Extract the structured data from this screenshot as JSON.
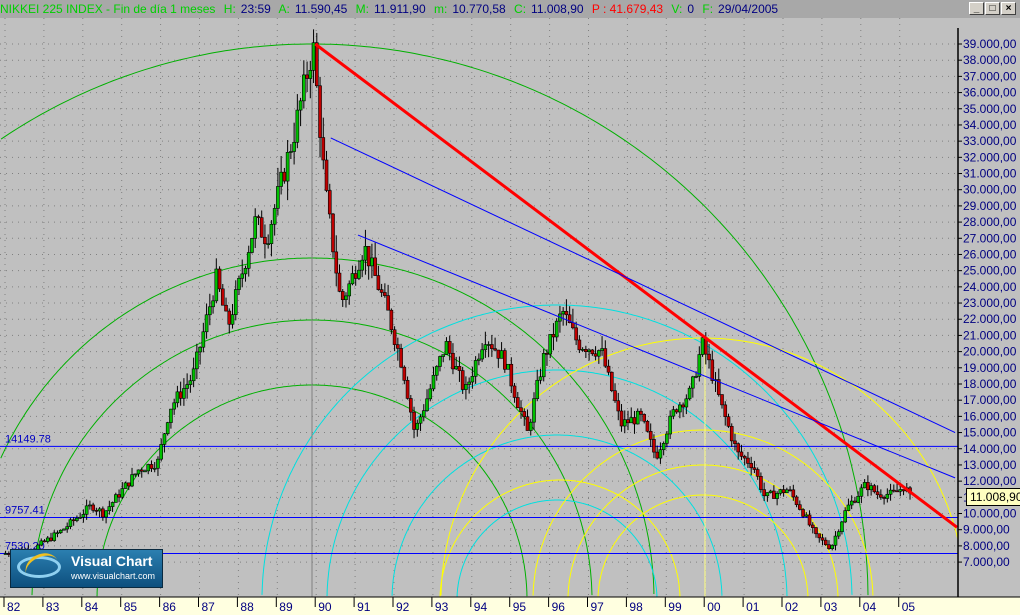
{
  "header": {
    "title": "NIKKEI 225 INDEX - Fin de día 1 meses",
    "h_label": "H:",
    "h": "23:59",
    "a_label": "A:",
    "a": "11.590,45",
    "m_label": "M:",
    "m": "11.911,90",
    "lo_label": "m:",
    "lo": "10.770,58",
    "c_label": "C:",
    "c": "11.008,90",
    "p": "P : 41.679,43",
    "v_label": "V:",
    "v": "0",
    "f_label": "F:",
    "f": "29/04/2005"
  },
  "window_buttons": {
    "minimize": "_",
    "maximize": "□",
    "close": "×"
  },
  "logo": {
    "name": "Visual Chart",
    "url": "www.visualchart.com"
  },
  "current_price": "11.008,90",
  "colors": {
    "background": "#c0c0c0",
    "up": "#00c000",
    "down": "#c00000",
    "trend": "#ff0000",
    "channel": "#0000ff",
    "arc_green": "#00b000",
    "arc_cyan": "#00e0e0",
    "arc_yellow": "#ffff00"
  },
  "chart_data": {
    "type": "candlestick",
    "title": "NIKKEI 225 INDEX",
    "ylim": [
      6000,
      40000
    ],
    "y_ticks": [
      7000,
      8000,
      9000,
      10000,
      11000,
      12000,
      13000,
      14000,
      15000,
      16000,
      17000,
      18000,
      19000,
      20000,
      21000,
      22000,
      23000,
      24000,
      25000,
      26000,
      27000,
      28000,
      29000,
      30000,
      31000,
      32000,
      33000,
      34000,
      35000,
      36000,
      37000,
      38000,
      39000
    ],
    "y_tick_labels": [
      "7.000,00",
      "8.000,00",
      "9.000,00",
      "10.000,00",
      "11.000,00",
      "12.000,00",
      "13.000,00",
      "14.000,00",
      "15.000,00",
      "16.000,00",
      "17.000,00",
      "18.000,00",
      "19.000,00",
      "20.000,00",
      "21.000,00",
      "22.000,00",
      "23.000,00",
      "24.000,00",
      "25.000,00",
      "26.000,00",
      "27.000,00",
      "28.000,00",
      "29.000,00",
      "30.000,00",
      "31.000,00",
      "32.000,00",
      "33.000,00",
      "34.000,00",
      "35.000,00",
      "36.000,00",
      "37.000,00",
      "38.000,00",
      "39.000,00"
    ],
    "x_ticks": [
      1982,
      1983,
      1984,
      1985,
      1986,
      1987,
      1988,
      1989,
      1990,
      1991,
      1992,
      1993,
      1994,
      1995,
      1996,
      1997,
      1998,
      1999,
      2000,
      2001,
      2002,
      2003,
      2004,
      2005
    ],
    "x_tick_labels": [
      "82",
      "83",
      "84",
      "85",
      "86",
      "87",
      "88",
      "89",
      "90",
      "91",
      "92",
      "93",
      "94",
      "95",
      "96",
      "97",
      "98",
      "99",
      "00",
      "01",
      "02",
      "03",
      "04",
      "05"
    ],
    "keypoints": [
      [
        1982.0,
        7500
      ],
      [
        1982.8,
        7800
      ],
      [
        1983.5,
        8900
      ],
      [
        1984.3,
        10500
      ],
      [
        1984.6,
        10000
      ],
      [
        1985.5,
        12700
      ],
      [
        1986.0,
        13200
      ],
      [
        1986.3,
        16500
      ],
      [
        1986.9,
        18500
      ],
      [
        1987.5,
        24500
      ],
      [
        1987.8,
        21500
      ],
      [
        1988.5,
        28000
      ],
      [
        1988.8,
        27000
      ],
      [
        1989.5,
        33500
      ],
      [
        1989.99,
        38900
      ],
      [
        1990.3,
        30000
      ],
      [
        1990.7,
        23000
      ],
      [
        1990.9,
        24000
      ],
      [
        1991.3,
        26500
      ],
      [
        1991.9,
        22500
      ],
      [
        1992.3,
        19000
      ],
      [
        1992.6,
        15000
      ],
      [
        1992.9,
        17000
      ],
      [
        1993.4,
        20500
      ],
      [
        1993.9,
        17500
      ],
      [
        1994.4,
        21000
      ],
      [
        1994.9,
        19500
      ],
      [
        1995.5,
        15000
      ],
      [
        1995.9,
        19500
      ],
      [
        1996.4,
        22500
      ],
      [
        1996.8,
        20500
      ],
      [
        1997.4,
        20000
      ],
      [
        1997.9,
        15500
      ],
      [
        1998.4,
        16000
      ],
      [
        1998.8,
        13500
      ],
      [
        1999.3,
        16500
      ],
      [
        1999.7,
        17500
      ],
      [
        1999.99,
        20500
      ],
      [
        2000.2,
        19000
      ],
      [
        2000.5,
        16500
      ],
      [
        2000.9,
        13700
      ],
      [
        2001.3,
        13000
      ],
      [
        2001.6,
        11000
      ],
      [
        2002.2,
        11500
      ],
      [
        2002.6,
        10000
      ],
      [
        2002.9,
        8600
      ],
      [
        2003.3,
        7900
      ],
      [
        2003.7,
        10300
      ],
      [
        2004.2,
        11800
      ],
      [
        2004.5,
        11200
      ],
      [
        2004.9,
        11200
      ],
      [
        2005.2,
        11700
      ],
      [
        2005.33,
        11009
      ]
    ],
    "horizontal_lines": [
      {
        "value": 14149.78,
        "label": "14149.78"
      },
      {
        "value": 9757.41,
        "label": "9757.41"
      },
      {
        "value": 7530.2,
        "label": "7530.20"
      }
    ],
    "trend_lines": [
      {
        "color": "red",
        "from": [
          1990.0,
          39000
        ],
        "to": [
          2006.5,
          9150
        ]
      },
      {
        "color": "blue",
        "from": [
          1990.4,
          33200
        ],
        "to": [
          2006.45,
          15000
        ]
      },
      {
        "color": "blue",
        "from": [
          1991.1,
          27200
        ],
        "to": [
          2006.45,
          12200
        ]
      }
    ]
  }
}
